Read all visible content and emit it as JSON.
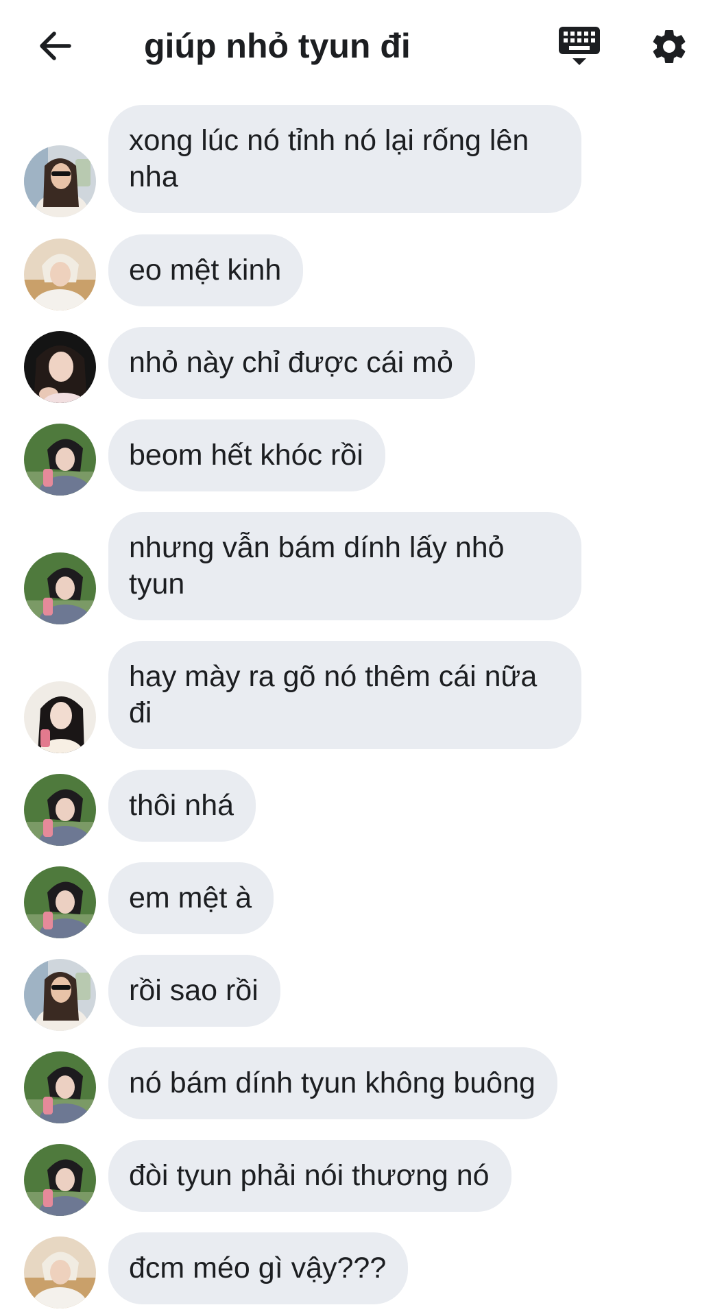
{
  "header": {
    "title": "giúp nhỏ tyun đi",
    "back_icon": "arrow-left-icon",
    "keyboard_icon": "keyboard-icon",
    "settings_icon": "gear-icon"
  },
  "colors": {
    "bubble_bg": "#e9ecf1",
    "text": "#1c1e21",
    "background": "#ffffff"
  },
  "messages": [
    {
      "text": "xong lúc nó tỉnh nó lại rống lên nha",
      "avatar": "user-a"
    },
    {
      "text": "eo mệt kinh",
      "avatar": "user-b"
    },
    {
      "text": "nhỏ này chỉ được cái mỏ",
      "avatar": "user-c"
    },
    {
      "text": "beom hết khóc rồi",
      "avatar": "user-d"
    },
    {
      "text": "nhưng vẫn bám dính lấy nhỏ tyun",
      "avatar": "user-d"
    },
    {
      "text": "hay mày ra gõ nó thêm cái nữa đi",
      "avatar": "user-e"
    },
    {
      "text": "thôi nhá",
      "avatar": "user-d"
    },
    {
      "text": "em mệt à",
      "avatar": "user-d"
    },
    {
      "text": "rồi sao rồi",
      "avatar": "user-a"
    },
    {
      "text": "nó bám dính tyun không buông",
      "avatar": "user-d"
    },
    {
      "text": "đòi tyun phải nói thương nó",
      "avatar": "user-d"
    },
    {
      "text": "đcm méo gì vậy???",
      "avatar": "user-b"
    }
  ]
}
